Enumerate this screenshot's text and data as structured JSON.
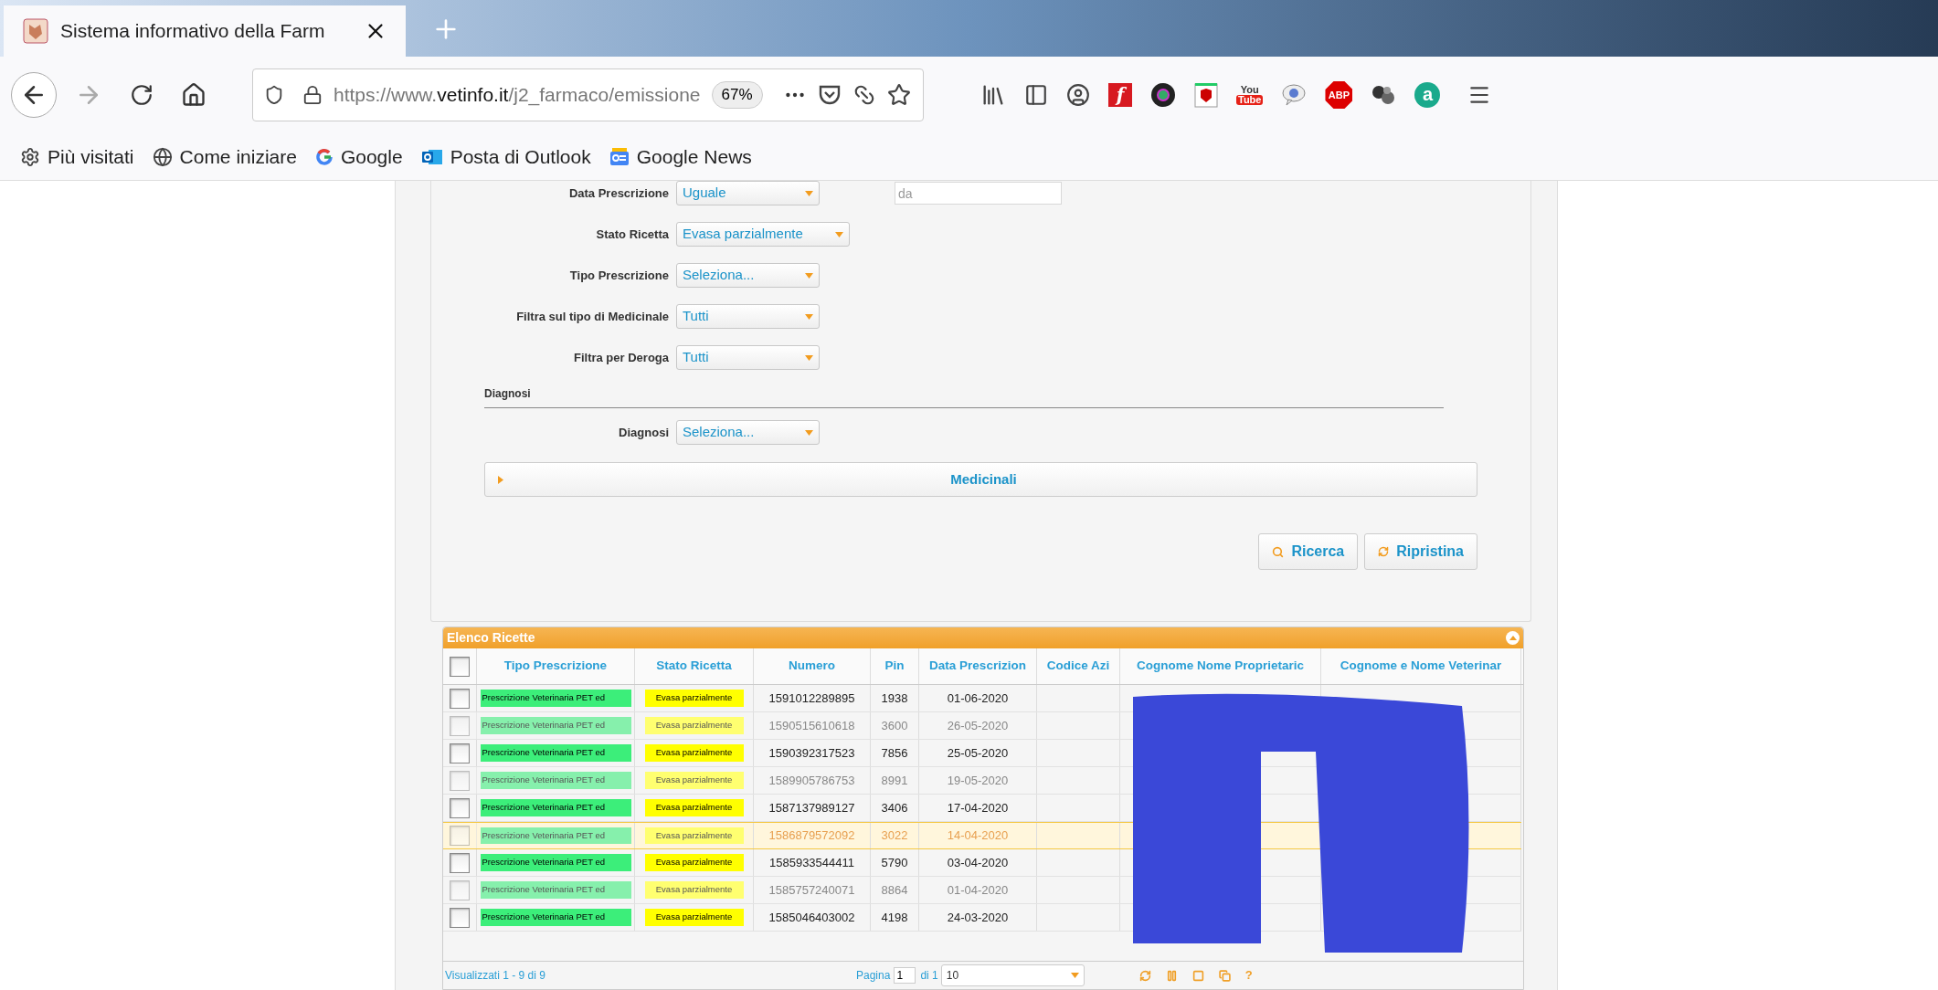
{
  "browser": {
    "tab": {
      "title": "Sistema informativo della Farm"
    },
    "url": {
      "prefix": "https://www.",
      "domain": "vetinfo.it",
      "path": "/j2_farmaco/emissione"
    },
    "zoom": "67%",
    "extensions": [
      {
        "kind": "flash",
        "label": "f"
      },
      {
        "kind": "lens"
      },
      {
        "kind": "shield"
      },
      {
        "kind": "youtube",
        "label": "You",
        "label2": "Tube"
      },
      {
        "kind": "chat"
      },
      {
        "kind": "abp",
        "label": "ABP"
      },
      {
        "kind": "balls"
      },
      {
        "kind": "letter",
        "label": "a"
      }
    ],
    "bookmarks": [
      {
        "kind": "gear",
        "label": "Più visitati"
      },
      {
        "kind": "globe",
        "label": "Come iniziare"
      },
      {
        "kind": "google",
        "label": "Google"
      },
      {
        "kind": "outlook",
        "label": "Posta di Outlook"
      },
      {
        "kind": "news",
        "label": "Google News"
      }
    ]
  },
  "form": {
    "fields": [
      {
        "label": "Data Prescrizione",
        "value": "Uguale",
        "wide": false,
        "date_placeholder": "da"
      },
      {
        "label": "Stato Ricetta",
        "value": "Evasa parzialmente",
        "wide": true
      },
      {
        "label": "Tipo Prescrizione",
        "value": "Seleziona...",
        "wide": false
      },
      {
        "label": "Filtra sul tipo di Medicinale",
        "value": "Tutti",
        "wide": false
      },
      {
        "label": "Filtra per Deroga",
        "value": "Tutti",
        "wide": false
      }
    ],
    "section": "Diagnosi",
    "section_fields": [
      {
        "label": "Diagnosi",
        "value": "Seleziona...",
        "wide": false
      }
    ],
    "accordion": {
      "title": "Medicinali",
      "expanded": false
    },
    "buttons": [
      {
        "kind": "search",
        "label": "Ricerca"
      },
      {
        "kind": "reset",
        "label": "Ripristina"
      }
    ]
  },
  "grid": {
    "title": "Elenco Ricette",
    "select_all": {
      "checked": false
    },
    "columns": [
      "Tipo Prescrizione",
      "Stato Ricetta",
      "Numero",
      "Pin",
      "Data Prescrizion",
      "Codice Azi",
      "Cognome Nome Proprietaric",
      "Cognome e Nome Veterinar"
    ],
    "rows": [
      {
        "checked": false,
        "dimmed": false,
        "selected": false,
        "cells": [
          "Prescrizione Veterinaria PET ed",
          "Evasa parzialmente",
          "1591012289895",
          "1938",
          "01-06-2020"
        ]
      },
      {
        "checked": false,
        "dimmed": true,
        "selected": false,
        "cells": [
          "Prescrizione Veterinaria PET ed",
          "Evasa parzialmente",
          "1590515610618",
          "3600",
          "26-05-2020"
        ]
      },
      {
        "checked": false,
        "dimmed": false,
        "selected": false,
        "cells": [
          "Prescrizione Veterinaria PET ed",
          "Evasa parzialmente",
          "1590392317523",
          "7856",
          "25-05-2020"
        ]
      },
      {
        "checked": false,
        "dimmed": true,
        "selected": false,
        "cells": [
          "Prescrizione Veterinaria PET ed",
          "Evasa parzialmente",
          "1589905786753",
          "8991",
          "19-05-2020"
        ]
      },
      {
        "checked": false,
        "dimmed": false,
        "selected": false,
        "cells": [
          "Prescrizione Veterinaria PET ed",
          "Evasa parzialmente",
          "1587137989127",
          "3406",
          "17-04-2020"
        ]
      },
      {
        "checked": false,
        "dimmed": true,
        "selected": true,
        "cells": [
          "Prescrizione Veterinaria PET ed",
          "Evasa parzialmente",
          "1586879572092",
          "3022",
          "14-04-2020"
        ]
      },
      {
        "checked": false,
        "dimmed": false,
        "selected": false,
        "cells": [
          "Prescrizione Veterinaria PET ed",
          "Evasa parzialmente",
          "1585933544411",
          "5790",
          "03-04-2020"
        ]
      },
      {
        "checked": false,
        "dimmed": true,
        "selected": false,
        "cells": [
          "Prescrizione Veterinaria PET ed",
          "Evasa parzialmente",
          "1585757240071",
          "8864",
          "01-04-2020"
        ]
      },
      {
        "checked": false,
        "dimmed": false,
        "selected": false,
        "cells": [
          "Prescrizione Veterinaria PET ed",
          "Evasa parzialmente",
          "1585046403002",
          "4198",
          "24-03-2020"
        ]
      }
    ],
    "footer": {
      "summary": "Visualizzati 1 - 9 di 9",
      "page_label": "Pagina",
      "page": "1",
      "of": "di 1",
      "page_size": "10",
      "help": "?"
    }
  }
}
